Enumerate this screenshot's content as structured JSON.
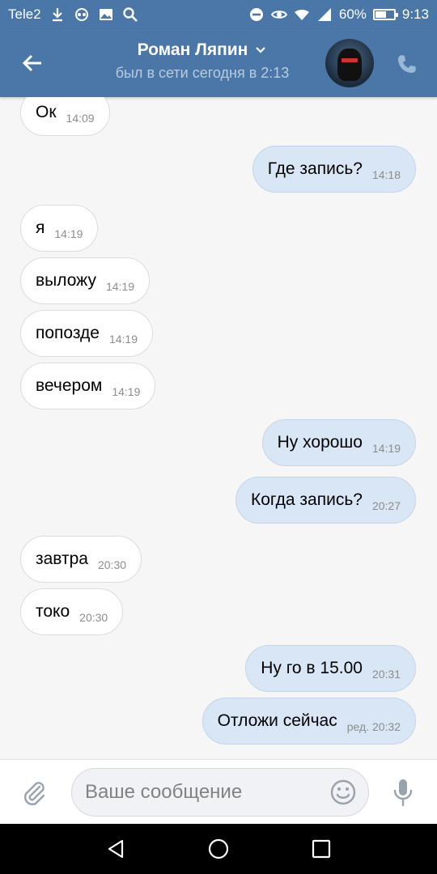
{
  "status_bar": {
    "carrier": "Tele2",
    "battery_percent": "60%",
    "battery_level": 0.6,
    "time": "9:13",
    "icons_left": [
      "download-icon",
      "spy-app-icon",
      "image-icon",
      "search-icon"
    ],
    "icons_right": [
      "dnd-icon",
      "eye-icon",
      "wifi-icon",
      "signal-icon",
      "battery-icon"
    ]
  },
  "header": {
    "contact_name": "Роман Ляпин",
    "last_seen": "был в сети сегодня в 2:13",
    "colors": {
      "bar": "#4a76a8",
      "subtitle": "#b8cbe0"
    }
  },
  "messages": [
    {
      "dir": "in",
      "text": "Ок",
      "time": "14:09"
    },
    {
      "dir": "out",
      "text": "Где запись?",
      "time": "14:18"
    },
    {
      "dir": "in",
      "text": "я",
      "time": "14:19"
    },
    {
      "dir": "in",
      "text": "выложу",
      "time": "14:19"
    },
    {
      "dir": "in",
      "text": "попозде",
      "time": "14:19"
    },
    {
      "dir": "in",
      "text": "вечером",
      "time": "14:19"
    },
    {
      "dir": "out",
      "text": "Ну хорошо",
      "time": "14:19"
    },
    {
      "dir": "out",
      "text": "Когда запись?",
      "time": "20:27"
    },
    {
      "dir": "in",
      "text": "завтра",
      "time": "20:30"
    },
    {
      "dir": "in",
      "text": "токо",
      "time": "20:30"
    },
    {
      "dir": "out",
      "text": "Ну го в 15.00",
      "time": "20:31"
    },
    {
      "dir": "out",
      "text": "Отложи сейчас",
      "time": "ред. 20:32"
    }
  ],
  "composer": {
    "placeholder": "Ваше сообщение"
  },
  "colors": {
    "incoming_bubble": "#ffffff",
    "outgoing_bubble": "#d9e6f6",
    "background": "#f6f6f6"
  }
}
